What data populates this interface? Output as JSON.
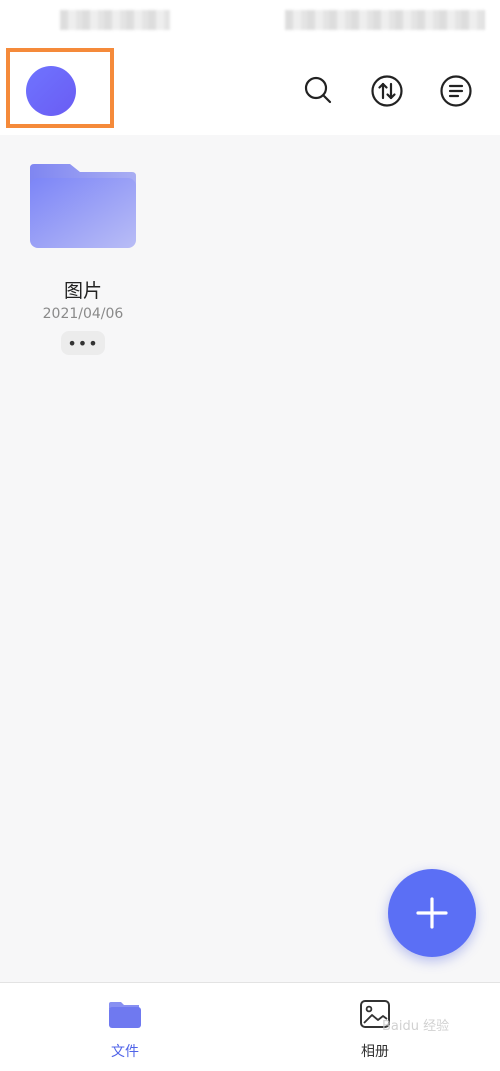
{
  "folder": {
    "name": "图片",
    "date": "2021/04/06",
    "more_label": "•••"
  },
  "bottom_nav": {
    "files_label": "文件",
    "album_label": "相册"
  },
  "colors": {
    "accent": "#5b6ff5",
    "highlight": "#f58a3a"
  },
  "watermark": {
    "text": "Baidu 经验"
  }
}
